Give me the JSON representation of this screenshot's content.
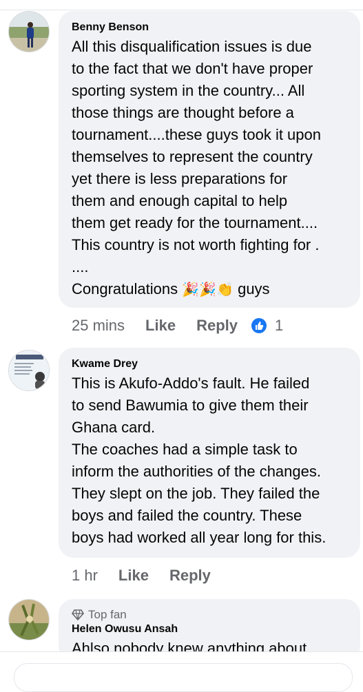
{
  "comments": [
    {
      "author": "Benny Benson",
      "text": "All this disqualification issues is due\nto the fact that we don't have proper\nsporting system in the country... All\nthose things are thought before a\ntournament....these guys took it upon\nthemselves to represent the country\nyet there is less preparations for\nthem and enough capital to help\nthem get ready for the tournament....\nThis country is not worth fighting for .\n....\nCongratulations",
      "text_tail": "guys",
      "emojis": "🎉🎉👏",
      "time": "25 mins",
      "like_label": "Like",
      "reply_label": "Reply",
      "reaction_count": "1"
    },
    {
      "author": "Kwame Drey",
      "text": "This is Akufo-Addo's fault. He failed\nto send Bawumia to give them their\nGhana card.\nThe coaches had a simple task to\ninform the authorities of the changes.\nThey slept on the job. They failed the\nboys and failed the country. These\nboys had worked all year long for this.",
      "time": "1 hr",
      "like_label": "Like",
      "reply_label": "Reply"
    },
    {
      "badge": "Top fan",
      "author": "Helen Owusu Ansah",
      "text": "Ahlso nobody knew anything about"
    }
  ]
}
